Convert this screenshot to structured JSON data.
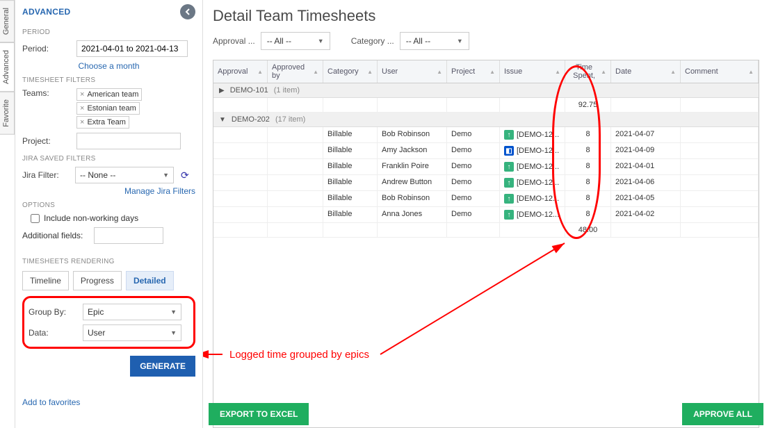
{
  "rail": {
    "general": "General",
    "advanced": "Advanced",
    "favorite": "Favorite"
  },
  "sidebar": {
    "title": "ADVANCED",
    "period_section": "PERIOD",
    "period_label": "Period:",
    "period_value": "2021-04-01 to 2021-04-13",
    "choose_month": "Choose a month",
    "filters_section": "TIMESHEET FILTERS",
    "teams_label": "Teams:",
    "teams": [
      "American team",
      "Estonian team",
      "Extra Team"
    ],
    "project_label": "Project:",
    "project_value": "",
    "jira_section": "JIRA SAVED FILTERS",
    "jira_label": "Jira Filter:",
    "jira_value": "-- None --",
    "manage_filters": "Manage Jira Filters",
    "options_section": "OPTIONS",
    "nonworking_label": "Include non-working days",
    "addfields_label": "Additional fields:",
    "addfields_value": "",
    "rendering_section": "TIMESHEETS RENDERING",
    "render": {
      "timeline": "Timeline",
      "progress": "Progress",
      "detailed": "Detailed"
    },
    "groupby_label": "Group By:",
    "groupby_value": "Epic",
    "data_label": "Data:",
    "data_value": "User",
    "generate": "GENERATE",
    "addfav": "Add to favorites"
  },
  "main": {
    "title": "Detail Team Timesheets",
    "approval_label": "Approval ...",
    "approval_value": "-- All --",
    "category_label": "Category ...",
    "category_value": "-- All --",
    "cols": {
      "approval": "Approval",
      "approvedby": "Approved by",
      "category": "Category",
      "user": "User",
      "project": "Project",
      "issue": "Issue",
      "time": "Time Spent,",
      "date": "Date",
      "comment": "Comment"
    },
    "group1": {
      "id": "DEMO-101",
      "count": "(1 item)",
      "time": "92.75"
    },
    "group2": {
      "id": "DEMO-202",
      "count": "(17 item)"
    },
    "rows": [
      {
        "cat": "Billable",
        "user": "Bob Robinson",
        "proj": "Demo",
        "ico": "green",
        "issue": "[DEMO-12...",
        "time": "8",
        "date": "2021-04-07"
      },
      {
        "cat": "Billable",
        "user": "Amy Jackson",
        "proj": "Demo",
        "ico": "blue",
        "issue": "[DEMO-12...",
        "time": "8",
        "date": "2021-04-09"
      },
      {
        "cat": "Billable",
        "user": "Franklin Poire",
        "proj": "Demo",
        "ico": "green",
        "issue": "[DEMO-12...",
        "time": "8",
        "date": "2021-04-01"
      },
      {
        "cat": "Billable",
        "user": "Andrew Button",
        "proj": "Demo",
        "ico": "green",
        "issue": "[DEMO-12...",
        "time": "8",
        "date": "2021-04-06"
      },
      {
        "cat": "Billable",
        "user": "Bob Robinson",
        "proj": "Demo",
        "ico": "green",
        "issue": "[DEMO-12...",
        "time": "8",
        "date": "2021-04-05"
      },
      {
        "cat": "Billable",
        "user": "Anna Jones",
        "proj": "Demo",
        "ico": "green",
        "issue": "[DEMO-12...",
        "time": "8",
        "date": "2021-04-02"
      }
    ],
    "total_time": "48.00",
    "annotation": "Logged time grouped by epics",
    "export": "EXPORT TO EXCEL",
    "approve": "APPROVE ALL"
  }
}
